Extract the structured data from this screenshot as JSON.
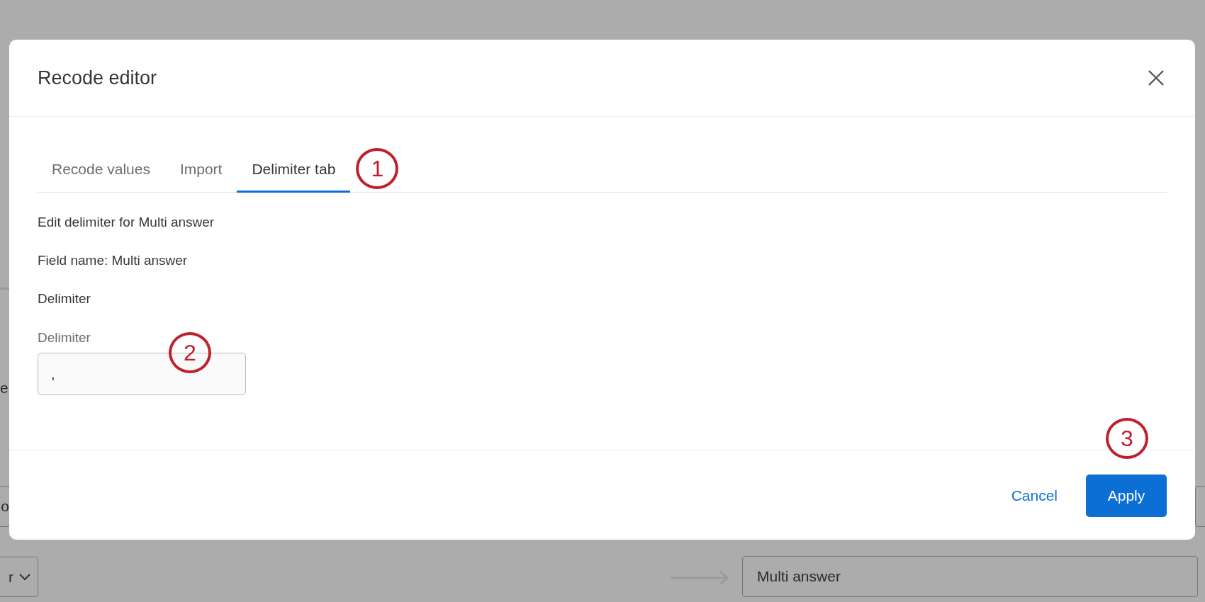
{
  "background": {
    "fragments": [
      {
        "kind": "text",
        "text": "e"
      },
      {
        "kind": "field",
        "text": "o"
      },
      {
        "kind": "dropdown",
        "text": "r"
      }
    ],
    "target_field": {
      "value": "Multi answer"
    }
  },
  "dialog": {
    "title": "Recode editor",
    "tabs": [
      {
        "label": "Recode values",
        "selected": false
      },
      {
        "label": "Import",
        "selected": false
      },
      {
        "label": "Delimiter tab",
        "selected": true
      }
    ],
    "lines": [
      "Edit delimiter for Multi answer",
      "Field name: Multi answer",
      "Delimiter"
    ],
    "field": {
      "label": "Delimiter",
      "value": ","
    },
    "buttons": [
      {
        "kind": "link",
        "label": "Cancel"
      },
      {
        "kind": "primary",
        "label": "Apply"
      }
    ]
  },
  "callouts": [
    "1",
    "2",
    "3"
  ]
}
